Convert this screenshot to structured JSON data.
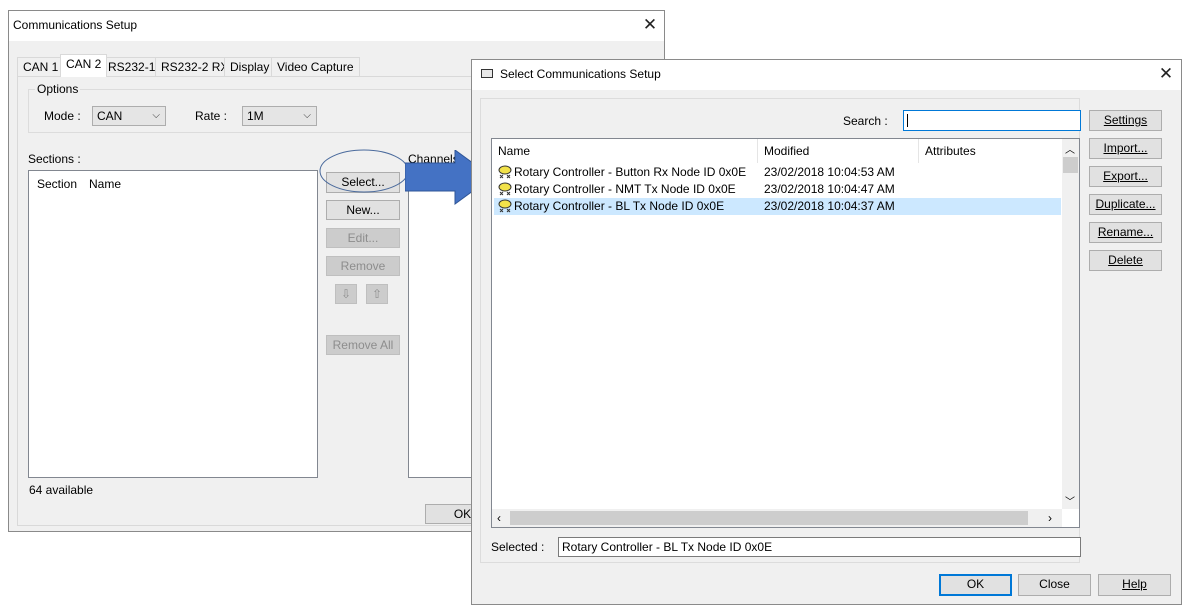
{
  "comm_setup": {
    "title": "Communications Setup",
    "tabs": [
      "CAN 1",
      "CAN 2",
      "RS232-1",
      "RS232-2 RX",
      "Display",
      "Video Capture"
    ],
    "active_tab": "CAN 2",
    "options_label": "Options",
    "mode_label": "Mode :",
    "mode_value": "CAN",
    "rate_label": "Rate :",
    "rate_value": "1M",
    "sections_label": "Sections :",
    "channels_label": "Channels :",
    "section_col": "Section",
    "name_col": "Name",
    "available": "64 available",
    "buttons": {
      "select": "Select...",
      "new": "New...",
      "edit": "Edit...",
      "remove": "Remove",
      "remove_all": "Remove All",
      "ok": "OK"
    }
  },
  "select_dialog": {
    "title": "Select Communications Setup",
    "search_label": "Search :",
    "search_value": "",
    "columns": {
      "name": "Name",
      "modified": "Modified",
      "attributes": "Attributes"
    },
    "rows": [
      {
        "name": "Rotary Controller - Button Rx Node ID 0x0E",
        "modified": "23/02/2018 10:04:53 AM",
        "selected": false
      },
      {
        "name": "Rotary Controller - NMT Tx Node ID 0x0E",
        "modified": "23/02/2018 10:04:47 AM",
        "selected": false
      },
      {
        "name": "Rotary Controller - BL Tx Node ID 0x0E",
        "modified": "23/02/2018 10:04:37 AM",
        "selected": true
      }
    ],
    "side_buttons": [
      "Settings",
      "Import...",
      "Export...",
      "Duplicate...",
      "Rename...",
      "Delete"
    ],
    "selected_label": "Selected :",
    "selected_value": "Rotary Controller - BL Tx Node ID 0x0E",
    "footer_buttons": {
      "ok": "OK",
      "close": "Close",
      "help": "Help"
    }
  },
  "colors": {
    "arrow": "#4472c4",
    "selection": "#cce8ff",
    "focus": "#0078d7"
  }
}
